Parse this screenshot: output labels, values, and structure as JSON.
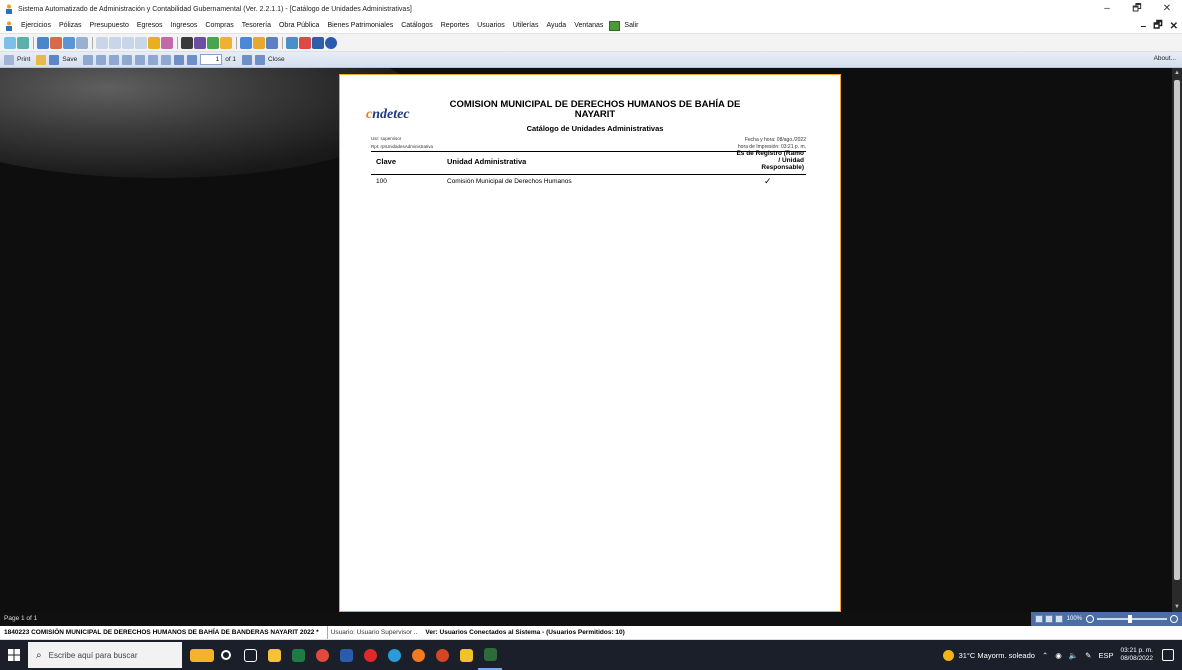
{
  "window": {
    "title": "Sistema Automatizado de Administración y Contabilidad Gubernamental  (Ver. 2.2.1.1) - [Catálogo de Unidades Administrativas]",
    "controls": [
      "–",
      "🗗",
      "✕"
    ]
  },
  "menu": {
    "items": [
      "Ejercicios",
      "Pólizas",
      "Presupuesto",
      "Egresos",
      "Ingresos",
      "Compras",
      "Tesorería",
      "Obra Pública",
      "Bienes Patrimoniales",
      "Catálogos",
      "Reportes",
      "Usuarios",
      "Utilerías",
      "Ayuda",
      "Ventanas",
      "Salir"
    ],
    "mdi_controls": [
      "–",
      "🗗",
      "✕"
    ]
  },
  "report_toolbar": {
    "print_label": "Print",
    "save_label": "Save",
    "page_value": "1",
    "of_label": "of 1",
    "close_label": "Close",
    "about_label": "About..."
  },
  "report": {
    "logo_text": "ndetec",
    "logo_initial": "c",
    "title": "COMISION MUNICIPAL DE DERECHOS HUMANOS DE BAHÍA DE NAYARIT",
    "subtitle": "Catálogo de Unidades Administrativas",
    "user_line": "Usr: supervisor",
    "report_line": "Rpt: rptUnidadesAdministrativa",
    "date_line": "Fecha y hora: 08/ago./2022",
    "time_line": "hora de Impresión: 03:21 p. m.",
    "columns": {
      "clave": "Clave",
      "unidad": "Unidad Administrativa",
      "registro": "Es de Registro (Ramo / Unidad Responsable)"
    },
    "rows": [
      {
        "clave": "100",
        "unidad": "Comisión Municipal de Derechos Humanos",
        "registro": "✓"
      }
    ]
  },
  "status": {
    "page": "Page 1 of 1",
    "zoom": "100%",
    "entity": "1840223 COMISIÓN MUNICIPAL DE DERECHOS HUMANOS DE BAHÍA DE BANDERAS NAYARIT  2022  *",
    "user": "Usuario: Usuario Supervisor ..",
    "connected": "Ver: Usuarios Conectados al Sistema - (Usuarios Permitidos: 10)"
  },
  "taskbar": {
    "search_placeholder": "Escribe aquí para buscar",
    "weather": "31°C  Mayorm. soleado",
    "lang": "ESP",
    "time": "03:21 p. m.",
    "date": "08/08/2022"
  }
}
